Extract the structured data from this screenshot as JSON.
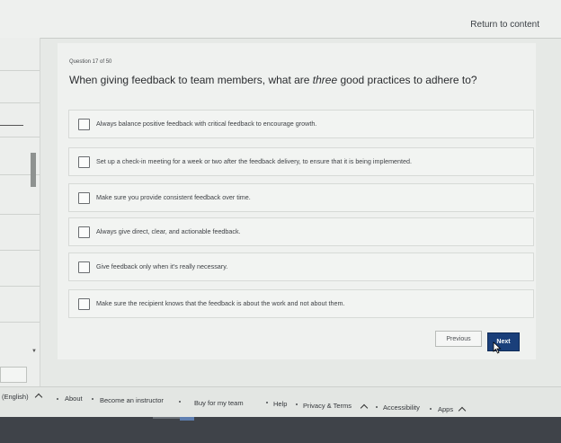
{
  "header": {
    "return_label": "Return to content"
  },
  "question": {
    "number_label": "Question 17 of 50",
    "text_before": "When giving feedback to team members, what are ",
    "text_emphasis": "three",
    "text_after": " good practices to adhere to?"
  },
  "options": [
    {
      "label": "Always balance positive feedback with critical feedback to encourage growth.",
      "checked": false
    },
    {
      "label": "Set up a check-in meeting for a week or two after the feedback delivery, to ensure that it is being implemented.",
      "checked": false
    },
    {
      "label": "Make sure you provide consistent feedback over time.",
      "checked": false
    },
    {
      "label": "Always give direct, clear, and actionable feedback.",
      "checked": false
    },
    {
      "label": "Give feedback only when it's really necessary.",
      "checked": false
    },
    {
      "label": "Make sure the recipient knows that the feedback is about the work and not about them.",
      "checked": false
    }
  ],
  "nav": {
    "previous_label": "Previous",
    "next_label": "Next"
  },
  "footer": {
    "language": "(English)",
    "about": "About",
    "instructor": "Become an instructor",
    "team": "Buy for my team",
    "help": "Help",
    "privacy": "Privacy & Terms",
    "accessibility": "Accessibility",
    "apps": "Apps"
  },
  "colors": {
    "primary_button": "#1a3f7a",
    "page_bg": "#e6e9e6"
  }
}
